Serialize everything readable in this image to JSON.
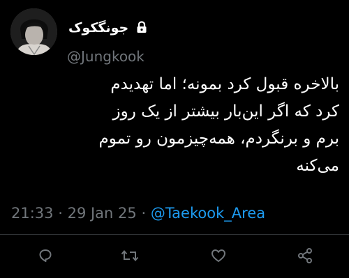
{
  "author": {
    "display_name": "جونگکوک",
    "handle": "@Jungkook",
    "protected_icon": "lock-icon",
    "avatar_icon": "profile-photo"
  },
  "tweet": {
    "lines": [
      "بالاخره قبول کرد بمونه؛ اما تهدیدم",
      "کرد که اگر این‌بار بیشتر از یک روز",
      "برم و برنگردم، همه‌چیزمون رو تموم",
      "می‌کنه"
    ]
  },
  "meta": {
    "time": "21:33",
    "date": "29 Jan 25",
    "separator": "·",
    "source_link": "@Taekook_Area"
  },
  "actions": {
    "reply_icon": "reply-icon",
    "retweet_icon": "retweet-icon",
    "like_icon": "like-icon",
    "share_icon": "share-icon"
  },
  "colors": {
    "background": "#000000",
    "text": "#ffffff",
    "secondary": "#71767b",
    "link": "#1d9bf0",
    "divider": "#2f3336"
  }
}
